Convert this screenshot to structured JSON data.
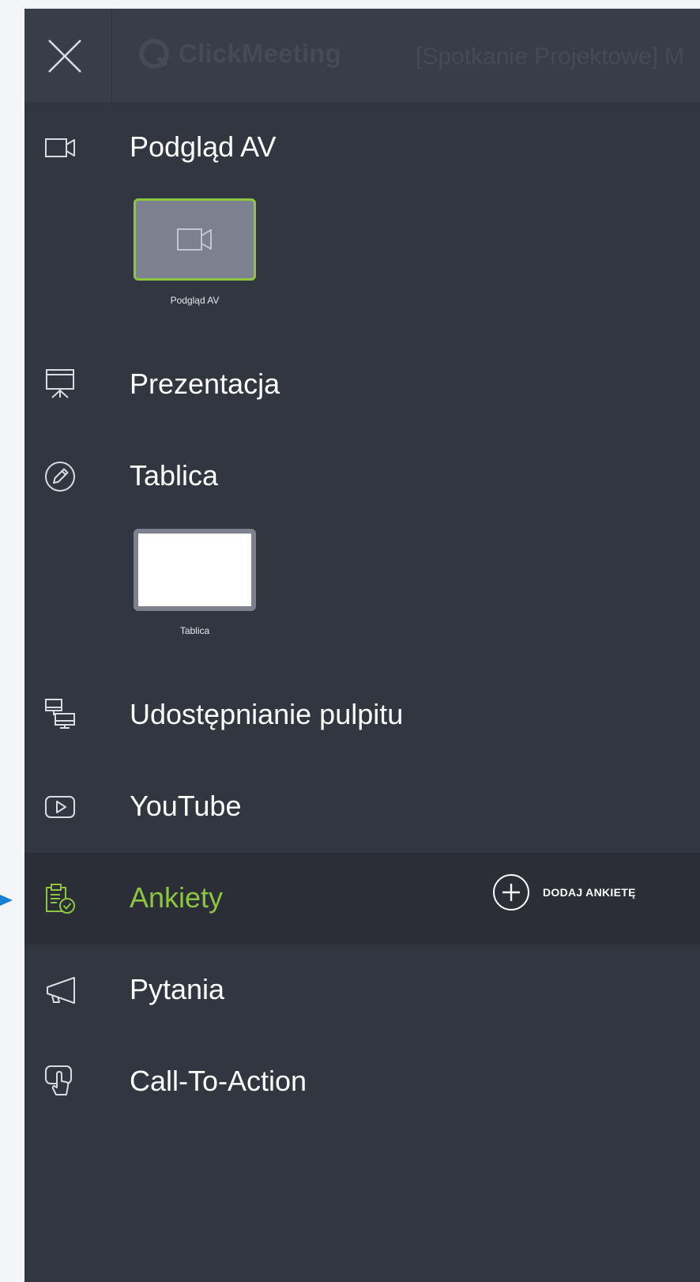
{
  "header": {
    "brand": "ClickMeeting",
    "meeting_title": "[Spotkanie Projektowe] M"
  },
  "menu": {
    "av_preview": {
      "label": "Podgląd AV",
      "icon": "camera-icon"
    },
    "presentation": {
      "label": "Prezentacja",
      "icon": "presentation-board-icon"
    },
    "whiteboard": {
      "label": "Tablica",
      "icon": "pencil-circle-icon"
    },
    "screen_share": {
      "label": "Udostępnianie pulpitu",
      "icon": "desktop-share-icon"
    },
    "youtube": {
      "label": "YouTube",
      "icon": "play-button-icon"
    },
    "polls": {
      "label": "Ankiety",
      "icon": "clipboard-check-icon",
      "action_label": "DODAJ ANKIETĘ"
    },
    "questions": {
      "label": "Pytania",
      "icon": "megaphone-icon"
    },
    "cta": {
      "label": "Call-To-Action",
      "icon": "hand-pointer-icon"
    }
  },
  "thumbnails": {
    "av_preview": "Podgląd AV",
    "whiteboard": "Tablica"
  },
  "colors": {
    "panel_bg": "#323641",
    "active_bg": "#2b2e37",
    "accent_green": "#8cc63f",
    "annotation_arrow": "#1a7fd0"
  }
}
